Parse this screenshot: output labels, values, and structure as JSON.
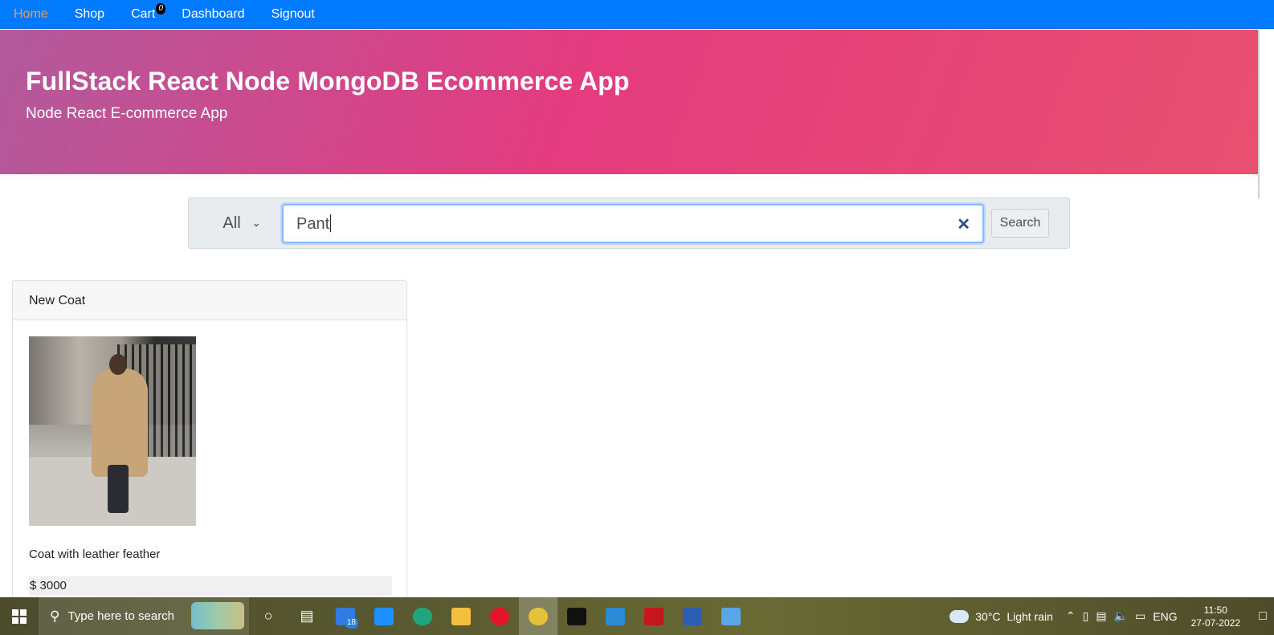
{
  "nav": {
    "items": [
      {
        "label": "Home",
        "active": true
      },
      {
        "label": "Shop",
        "active": false
      },
      {
        "label": "Cart",
        "active": false
      },
      {
        "label": "Dashboard",
        "active": false
      },
      {
        "label": "Signout",
        "active": false
      }
    ],
    "cart_count": "0",
    "bg_color": "#007bff",
    "active_color": "#ff9a3c"
  },
  "hero": {
    "title": "FullStack React Node MongoDB Ecommerce App",
    "subtitle": "Node React E-commerce App"
  },
  "search": {
    "category_selected": "All",
    "query": "Pant",
    "button_label": "Search"
  },
  "product": {
    "name": "New Coat",
    "description": "Coat with leather feather",
    "price": "$ 3000",
    "image_icon": "coat-photo"
  },
  "taskbar": {
    "search_placeholder": "Type here to search",
    "mail_badge": "18",
    "weather_temp": "30°C",
    "weather_desc": "Light rain",
    "language": "ENG",
    "time": "11:50",
    "date": "27-07-2022"
  }
}
